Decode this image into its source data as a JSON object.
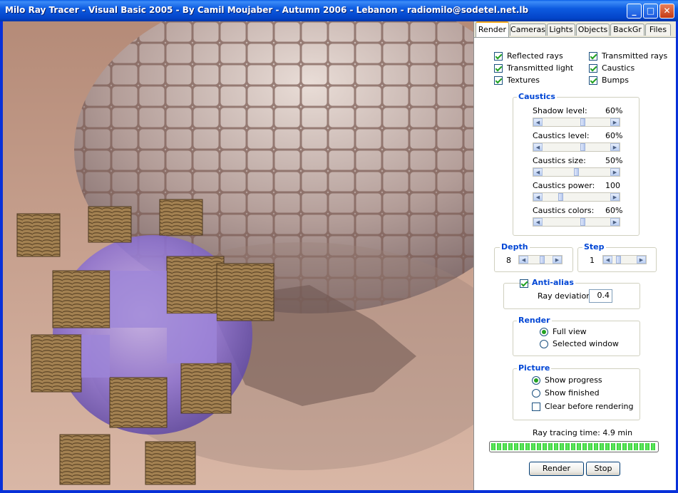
{
  "window": {
    "title": "Milo Ray Tracer - Visual Basic 2005 - By Camil Moujaber - Autumn 2006 - Lebanon - radiomilo@sodetel.net.lb",
    "controls": {
      "minimize": "_",
      "maximize": "□",
      "close": "✕"
    }
  },
  "tabs": [
    "Render",
    "Cameras",
    "Lights",
    "Objects",
    "BackGr",
    "Files"
  ],
  "active_tab": "Render",
  "options": {
    "reflected_rays": {
      "label": "Reflected rays",
      "checked": true
    },
    "transmitted_rays": {
      "label": "Transmitted rays",
      "checked": true
    },
    "transmitted_light": {
      "label": "Transmitted light",
      "checked": true
    },
    "caustics": {
      "label": "Caustics",
      "checked": true
    },
    "textures": {
      "label": "Textures",
      "checked": true
    },
    "bumps": {
      "label": "Bumps",
      "checked": true
    }
  },
  "caustics_group": {
    "title": "Caustics",
    "sliders": [
      {
        "label": "Shadow level:",
        "value": "60%",
        "level": 0.6
      },
      {
        "label": "Caustics level:",
        "value": "60%",
        "level": 0.6
      },
      {
        "label": "Caustics size:",
        "value": "50%",
        "level": 0.5
      },
      {
        "label": "Caustics power:",
        "value": "100",
        "level": 0.25
      },
      {
        "label": "Caustics colors:",
        "value": "60%",
        "level": 0.6
      }
    ]
  },
  "depth": {
    "title": "Depth",
    "value": "8",
    "level": 0.6
  },
  "step": {
    "title": "Step",
    "value": "1",
    "level": 0.2
  },
  "anti_alias": {
    "label": "Anti-alias",
    "checked": true,
    "ray_deviation_label": "Ray deviation:",
    "ray_deviation_value": "0.4"
  },
  "render_group": {
    "title": "Render",
    "options": [
      {
        "label": "Full view",
        "selected": true
      },
      {
        "label": "Selected window",
        "selected": false
      }
    ]
  },
  "picture_group": {
    "title": "Picture",
    "show_progress": {
      "label": "Show progress",
      "selected": true
    },
    "show_finished": {
      "label": "Show finished",
      "selected": false
    },
    "clear_before": {
      "label": "Clear before rendering",
      "checked": false
    }
  },
  "ray_tracing_time": "Ray tracing time: 4.9 min",
  "progress": 1.0,
  "buttons": {
    "render": "Render",
    "stop": "Stop"
  }
}
